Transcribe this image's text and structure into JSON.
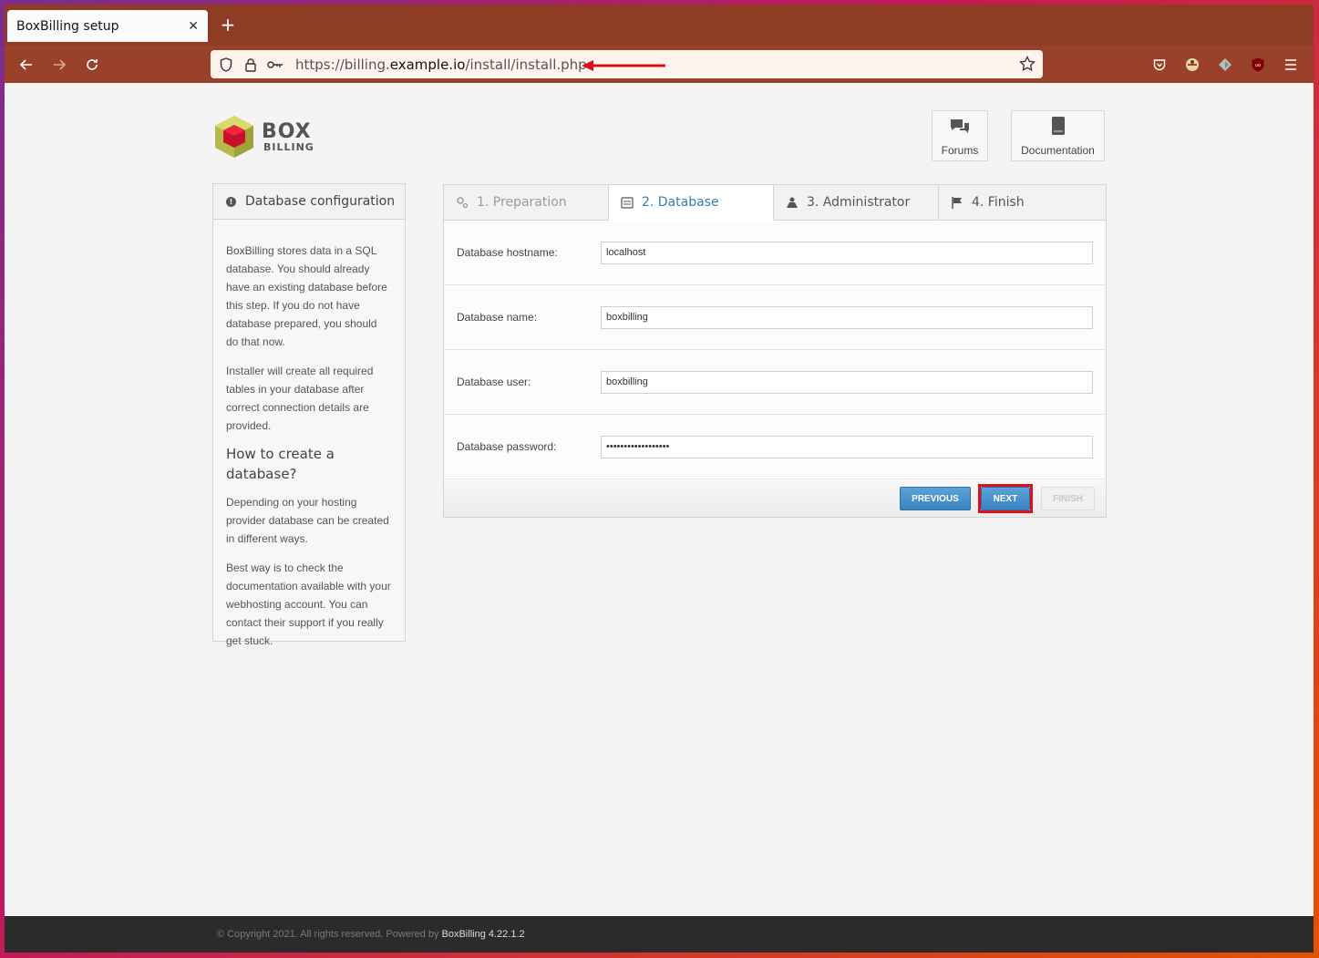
{
  "browser": {
    "tab_title": "BoxBilling setup",
    "url_prefix": "https://billing.",
    "url_host": "example.io",
    "url_path": "/install/install.php",
    "icons": [
      "back-icon",
      "forward-icon",
      "reload-icon",
      "shield-icon",
      "lock-icon",
      "key-icon",
      "star-icon",
      "pocket-icon",
      "extension-icon",
      "extension2-icon",
      "ublock-icon",
      "menu-icon"
    ]
  },
  "logo": {
    "line1": "BOX",
    "line2": "BILLING"
  },
  "header_buttons": {
    "forums": "Forums",
    "documentation": "Documentation"
  },
  "sidebar": {
    "title": "Database configuration",
    "p1": "BoxBilling stores data in a SQL database. You should already have an existing database before this step. If you do not have database prepared, you should do that now.",
    "p2": "Installer will create all required tables in your database after correct connection details are provided.",
    "heading": "How to create a database?",
    "p3": "Depending on your hosting provider database can be created in different ways.",
    "p4": "Best way is to check the documentation available with your webhosting account. You can contact their support if you really get stuck."
  },
  "steps": [
    {
      "label": "1. Preparation"
    },
    {
      "label": "2. Database"
    },
    {
      "label": "3. Administrator"
    },
    {
      "label": "4. Finish"
    }
  ],
  "form": {
    "hostname_label": "Database hostname:",
    "hostname_value": "localhost",
    "name_label": "Database name:",
    "name_value": "boxbilling",
    "user_label": "Database user:",
    "user_value": "boxbilling",
    "password_label": "Database password:",
    "password_value": "••••••••••••••••••"
  },
  "buttons": {
    "previous": "Previous",
    "next": "Next",
    "finish": "Finish"
  },
  "footer": {
    "copyright": "© Copyright 2021. All rights reserved. Powered by",
    "brand": "BoxBilling 4.22.1.2"
  },
  "colors": {
    "accent": "#2f7fb8",
    "highlight": "#e0101a",
    "chrome": "#9a4129"
  }
}
